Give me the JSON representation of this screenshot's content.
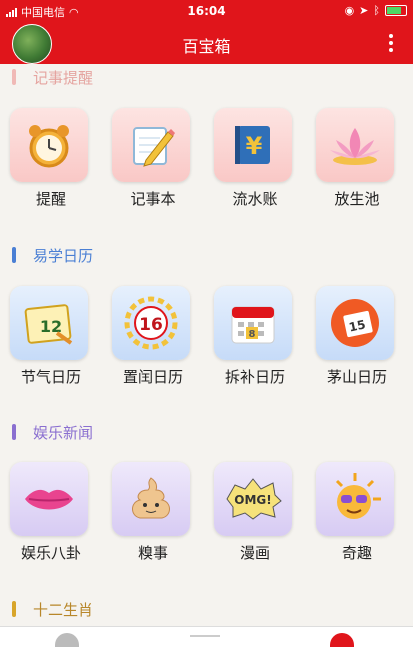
{
  "status": {
    "carrier": "中国电信",
    "time": "16:04"
  },
  "header": {
    "title": "百宝箱"
  },
  "sections": [
    {
      "title": "记事提醒",
      "color": "#e8a3a0",
      "items": [
        {
          "label": "提醒",
          "icon": "alarm-clock-icon"
        },
        {
          "label": "记事本",
          "icon": "notebook-pencil-icon"
        },
        {
          "label": "流水账",
          "icon": "yen-ledger-icon"
        },
        {
          "label": "放生池",
          "icon": "lotus-icon"
        }
      ]
    },
    {
      "title": "易学日历",
      "color": "#4a7fd4",
      "items": [
        {
          "label": "节气日历",
          "icon": "solar-term-calendar-icon",
          "badge": "12"
        },
        {
          "label": "置闰日历",
          "icon": "leap-calendar-icon",
          "badge": "16"
        },
        {
          "label": "拆补日历",
          "icon": "desk-calendar-icon",
          "badge": "8"
        },
        {
          "label": "茅山日历",
          "icon": "tear-calendar-icon",
          "badge": "15"
        }
      ]
    },
    {
      "title": "娱乐新闻",
      "color": "#8a6fd0",
      "items": [
        {
          "label": "娱乐八卦",
          "icon": "lips-icon"
        },
        {
          "label": "糗事",
          "icon": "poop-emoji-icon"
        },
        {
          "label": "漫画",
          "icon": "omg-comic-icon",
          "badge": "OMG!"
        },
        {
          "label": "奇趣",
          "icon": "sunglasses-sun-icon"
        }
      ]
    },
    {
      "title": "十二生肖",
      "color": "#d8a52a",
      "items": []
    }
  ],
  "colors": {
    "brand": "#e0151b"
  }
}
